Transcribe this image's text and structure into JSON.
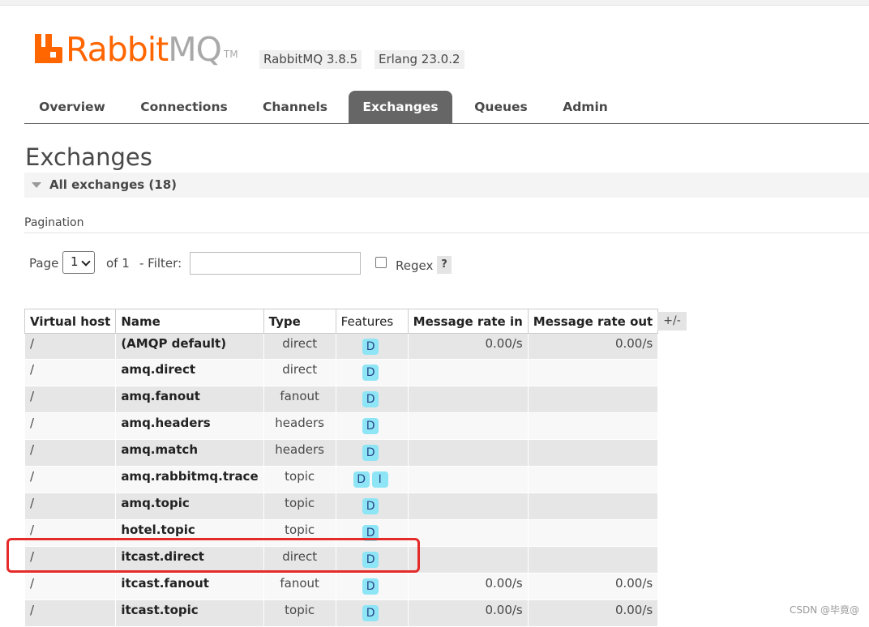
{
  "header": {
    "logo_text": "RabbitMQ",
    "logo_tm": "TM",
    "version": "RabbitMQ 3.8.5",
    "erlang": "Erlang 23.0.2",
    "brand_color": "#ff6600"
  },
  "tabs": [
    {
      "label": "Overview"
    },
    {
      "label": "Connections"
    },
    {
      "label": "Channels"
    },
    {
      "label": "Exchanges",
      "active": true
    },
    {
      "label": "Queues"
    },
    {
      "label": "Admin"
    }
  ],
  "page": {
    "title": "Exchanges",
    "section_title": "All exchanges (18)",
    "pagination_label": "Pagination"
  },
  "pagination": {
    "page_label": "Page",
    "page_value": "1",
    "of_label": "of 1",
    "filter_label": "- Filter:",
    "filter_value": "",
    "regex_label": "Regex",
    "help_label": "?"
  },
  "table": {
    "columns": [
      "Virtual host",
      "Name",
      "Type",
      "Features",
      "Message rate in",
      "Message rate out"
    ],
    "toggle_label": "+/-",
    "rows": [
      {
        "vhost": "/",
        "name": "(AMQP default)",
        "type": "direct",
        "features": [
          "D"
        ],
        "rate_in": "0.00/s",
        "rate_out": "0.00/s"
      },
      {
        "vhost": "/",
        "name": "amq.direct",
        "type": "direct",
        "features": [
          "D"
        ],
        "rate_in": "",
        "rate_out": ""
      },
      {
        "vhost": "/",
        "name": "amq.fanout",
        "type": "fanout",
        "features": [
          "D"
        ],
        "rate_in": "",
        "rate_out": ""
      },
      {
        "vhost": "/",
        "name": "amq.headers",
        "type": "headers",
        "features": [
          "D"
        ],
        "rate_in": "",
        "rate_out": ""
      },
      {
        "vhost": "/",
        "name": "amq.match",
        "type": "headers",
        "features": [
          "D"
        ],
        "rate_in": "",
        "rate_out": ""
      },
      {
        "vhost": "/",
        "name": "amq.rabbitmq.trace",
        "type": "topic",
        "features": [
          "D",
          "I"
        ],
        "rate_in": "",
        "rate_out": ""
      },
      {
        "vhost": "/",
        "name": "amq.topic",
        "type": "topic",
        "features": [
          "D"
        ],
        "rate_in": "",
        "rate_out": ""
      },
      {
        "vhost": "/",
        "name": "hotel.topic",
        "type": "topic",
        "features": [
          "D"
        ],
        "rate_in": "",
        "rate_out": ""
      },
      {
        "vhost": "/",
        "name": "itcast.direct",
        "type": "direct",
        "features": [
          "D"
        ],
        "rate_in": "",
        "rate_out": ""
      },
      {
        "vhost": "/",
        "name": "itcast.fanout",
        "type": "fanout",
        "features": [
          "D"
        ],
        "rate_in": "0.00/s",
        "rate_out": "0.00/s"
      },
      {
        "vhost": "/",
        "name": "itcast.topic",
        "type": "topic",
        "features": [
          "D"
        ],
        "rate_in": "0.00/s",
        "rate_out": "0.00/s"
      }
    ]
  },
  "highlight_color": "#e52a2a",
  "watermark": "CSDN @毕竟@"
}
